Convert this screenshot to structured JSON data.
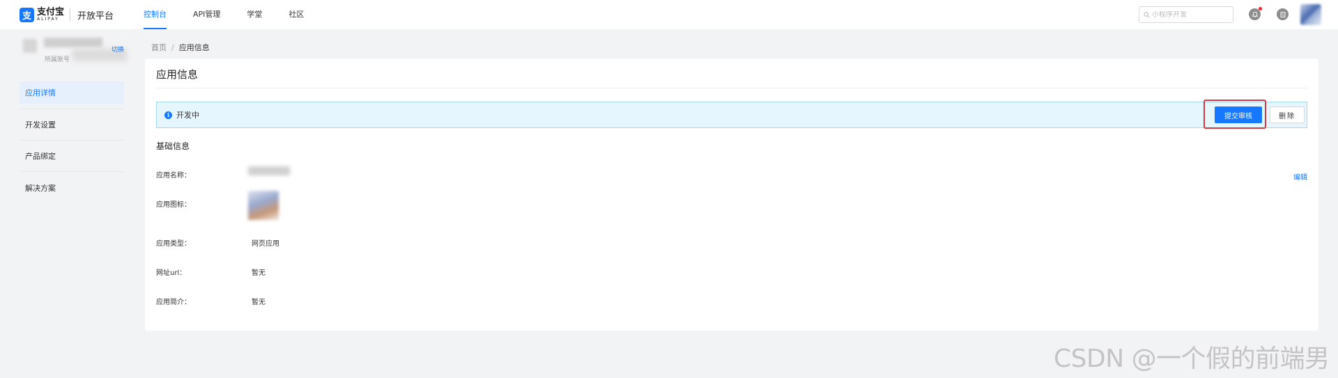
{
  "header": {
    "logo_mark": "支",
    "logo_cn": "支付宝",
    "logo_en": "ALIPAY",
    "platform": "开放平台",
    "nav": [
      {
        "label": "控制台",
        "active": true
      },
      {
        "label": "API管理",
        "active": false
      },
      {
        "label": "学堂",
        "active": false
      },
      {
        "label": "社区",
        "active": false
      }
    ],
    "search_placeholder": "小程序开发"
  },
  "sidebar": {
    "account_label": "所属账号",
    "switch_label": "切换",
    "items": [
      {
        "label": "应用详情",
        "active": true
      },
      {
        "label": "开发设置",
        "active": false
      },
      {
        "label": "产品绑定",
        "active": false
      },
      {
        "label": "解决方案",
        "active": false
      }
    ]
  },
  "breadcrumb": {
    "home": "首页",
    "separator": "/",
    "current": "应用信息"
  },
  "card": {
    "title": "应用信息",
    "status": "开发中",
    "info_glyph": "i",
    "submit_label": "提交审核",
    "delete_label": "删除",
    "section_title": "基础信息",
    "edit_label": "编辑",
    "fields": [
      {
        "label": "应用名称：",
        "value": ""
      },
      {
        "label": "应用图标：",
        "value": ""
      },
      {
        "label": "应用类型：",
        "value": "网页应用"
      },
      {
        "label": "网址url：",
        "value": "暂无"
      },
      {
        "label": "应用简介：",
        "value": "暂无"
      }
    ]
  },
  "watermark": "CSDN @一个假的前端男",
  "colors": {
    "primary": "#1677ff",
    "highlight": "#d9363e",
    "status_bg": "#e6f6ff"
  }
}
